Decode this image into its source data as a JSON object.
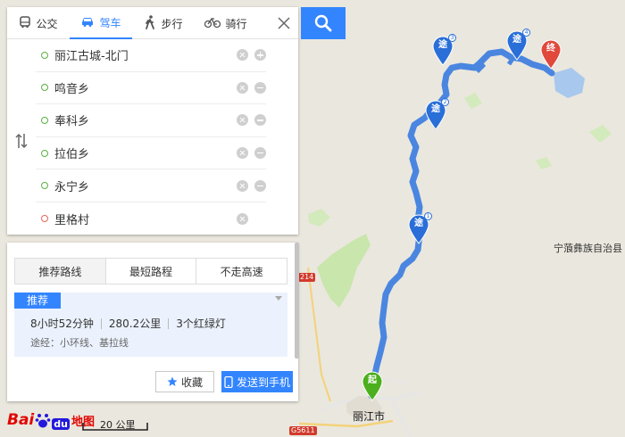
{
  "mode_tabs": [
    {
      "label": "公交",
      "icon": "bus-icon",
      "active": false
    },
    {
      "label": "驾车",
      "icon": "car-icon",
      "active": true
    },
    {
      "label": "步行",
      "icon": "walk-icon",
      "active": false
    },
    {
      "label": "骑行",
      "icon": "bike-icon",
      "active": false
    }
  ],
  "waypoints": [
    {
      "text": "丽江古城-北门",
      "action": "add"
    },
    {
      "text": "鸣音乡",
      "action": "remove"
    },
    {
      "text": "奉科乡",
      "action": "remove"
    },
    {
      "text": "拉伯乡",
      "action": "remove"
    },
    {
      "text": "永宁乡",
      "action": "remove"
    },
    {
      "text": "里格村",
      "action": "none"
    }
  ],
  "route_options": {
    "tabs": [
      "推荐路线",
      "最短路程",
      "不走高速"
    ],
    "active_index": 0
  },
  "route_card": {
    "badge": "推荐",
    "duration": "8小时52分钟",
    "distance": "280.2公里",
    "traffic_lights": "3个红绿灯",
    "via_label": "途经：",
    "via_value": "小环线、基拉线"
  },
  "actions": {
    "collect": "收藏",
    "send_to_phone": "发送到手机"
  },
  "map": {
    "place_labels": {
      "city": "丽江市",
      "county": "宁蒗彝族自治县"
    },
    "road_shields": [
      "214",
      "G5611"
    ],
    "pins": {
      "start": "起",
      "end": "终",
      "via": "途",
      "via_numbers": [
        "1",
        "2",
        "3",
        "4"
      ]
    },
    "route_color": "#4a86e0",
    "start_color": "#4caf1d",
    "end_color": "#e0493c",
    "via_color": "#2a6fd8"
  },
  "footer": {
    "logo_bai": "Bai",
    "logo_du": "du",
    "logo_map": "地图",
    "scale": "20 公里"
  },
  "colors": {
    "accent": "#3385ff",
    "map_bg": "#eae7de",
    "green_area": "#c5e3a9",
    "water": "#a8c8ee"
  }
}
